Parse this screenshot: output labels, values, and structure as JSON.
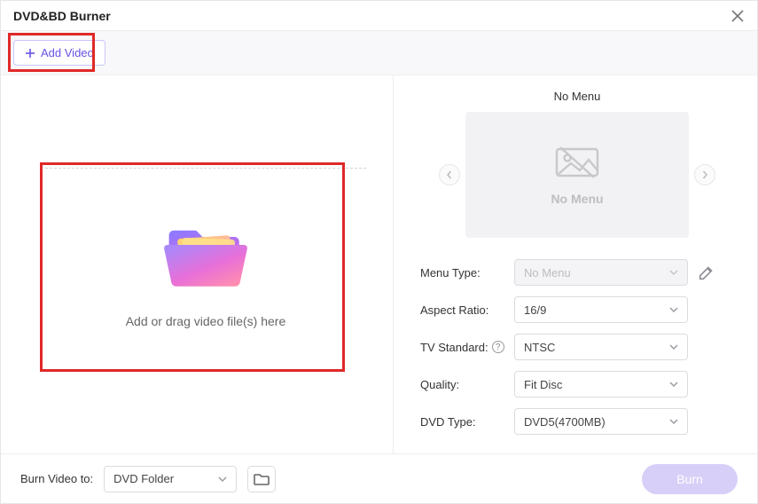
{
  "window": {
    "title": "DVD&BD Burner"
  },
  "toolbar": {
    "add_video": "Add Video"
  },
  "drop_area": {
    "hint": "Add or drag video file(s) here"
  },
  "preview": {
    "title": "No Menu",
    "placeholder_label": "No Menu"
  },
  "controls": {
    "rows": [
      {
        "label": "Menu Type:",
        "value": "No Menu",
        "disabled": true,
        "edit": true,
        "help": false
      },
      {
        "label": "Aspect Ratio:",
        "value": "16/9",
        "disabled": false,
        "edit": false,
        "help": false
      },
      {
        "label": "TV Standard:",
        "value": "NTSC",
        "disabled": false,
        "edit": false,
        "help": true
      },
      {
        "label": "Quality:",
        "value": "Fit Disc",
        "disabled": false,
        "edit": false,
        "help": false
      },
      {
        "label": "DVD Type:",
        "value": "DVD5(4700MB)",
        "disabled": false,
        "edit": false,
        "help": false
      }
    ]
  },
  "footer": {
    "label": "Burn Video to:",
    "target": "DVD Folder",
    "burn": "Burn"
  }
}
